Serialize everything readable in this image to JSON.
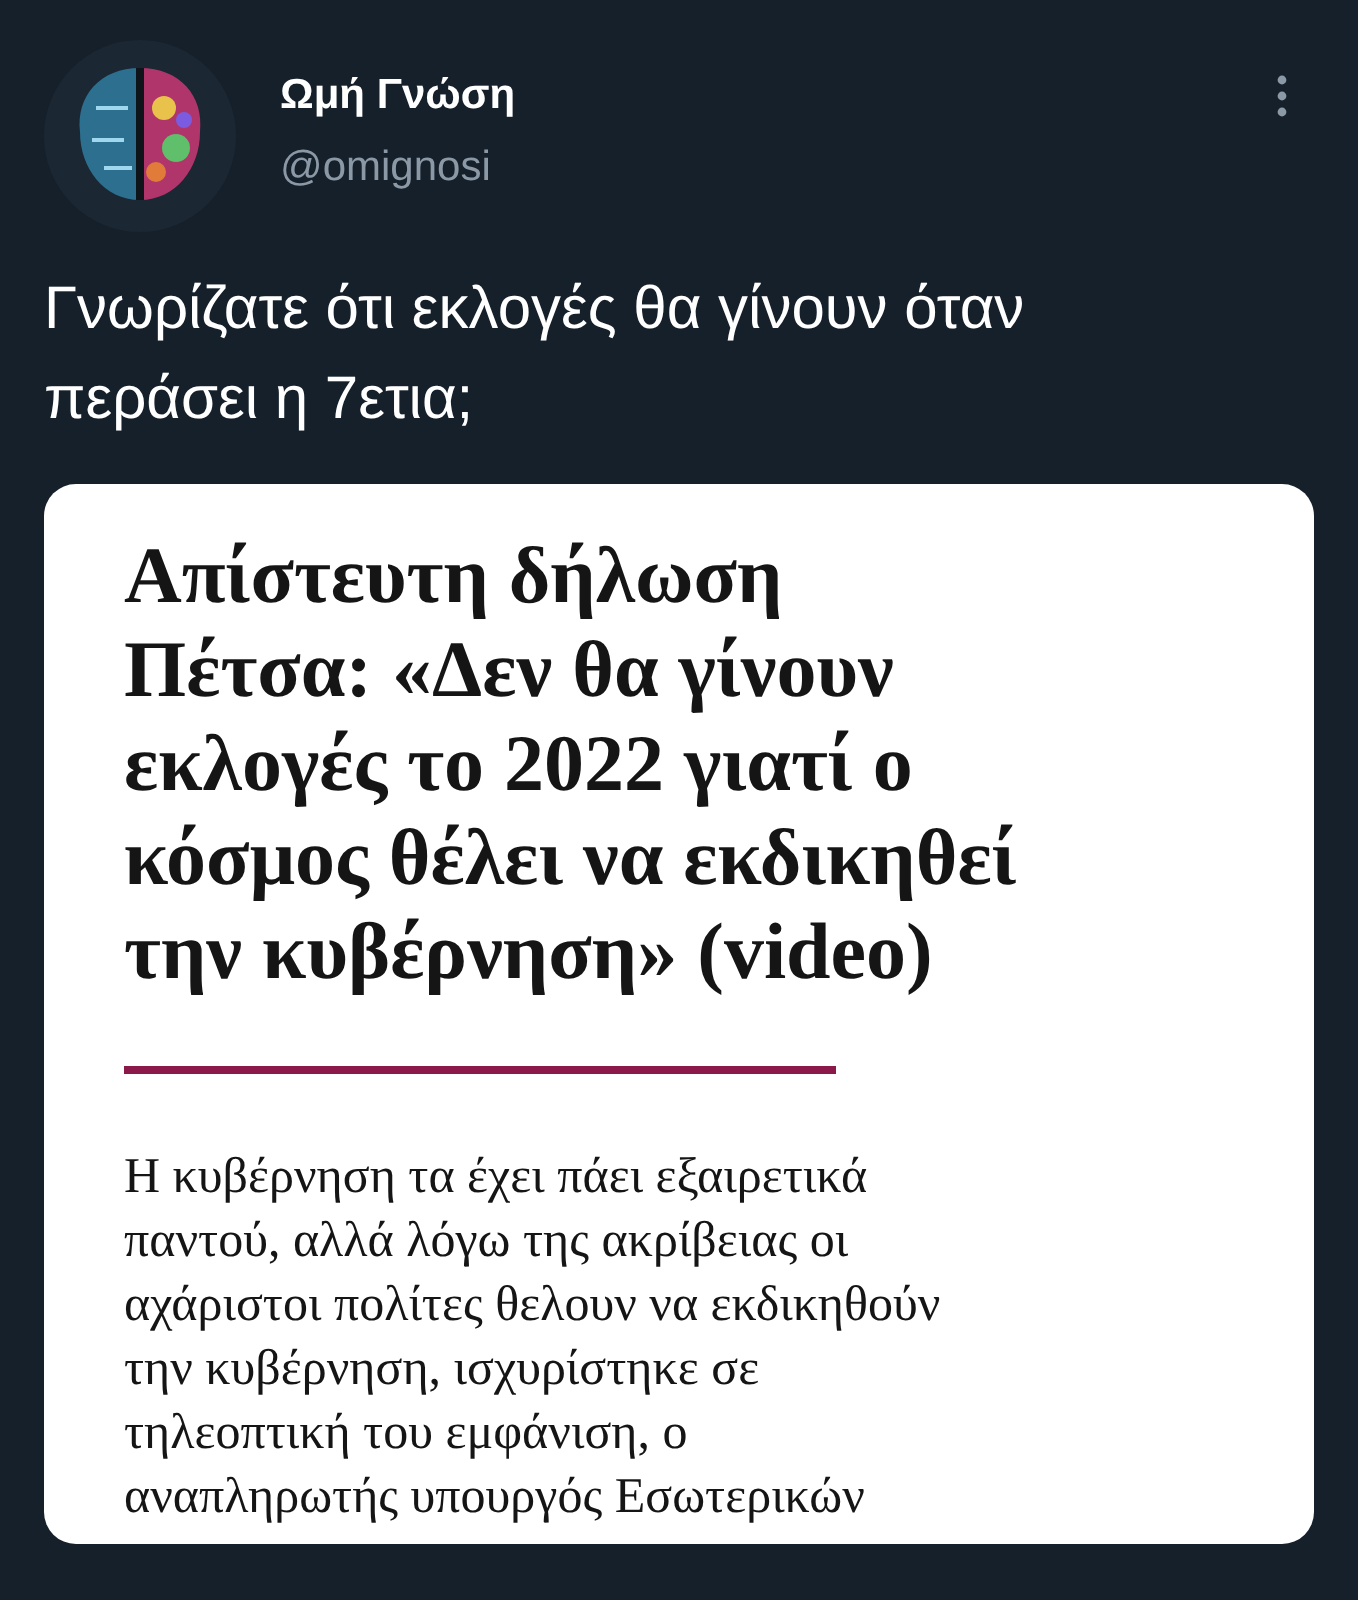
{
  "author": {
    "name": "Ωμή Γνώση",
    "handle": "@omignosi"
  },
  "tweet_text": "Γνωρίζατε ότι εκλογές θα γίνουν όταν περάσει η 7ετια;",
  "attached_image": {
    "headline_lines": [
      "Απίστευτη δήλωση",
      "Πέτσα: «Δεν θα γίνουν",
      "εκλογές το 2022 γιατί ο",
      "κόσμος θέλει να εκδικηθεί",
      "την κυβέρνηση» (video)"
    ],
    "body_lines": [
      "Η κυβέρνηση τα έχει πάει εξαιρετικά",
      "παντού, αλλά λόγω της ακρίβειας οι",
      "αχάριστοι πολίτες θελουν να εκδικηθούν",
      "την κυβέρνηση, ισχυρίστηκε σε",
      "τηλεοπτική του εμφάνιση, ο",
      "αναπληρωτής υπουργός Εσωτερικών"
    ]
  }
}
